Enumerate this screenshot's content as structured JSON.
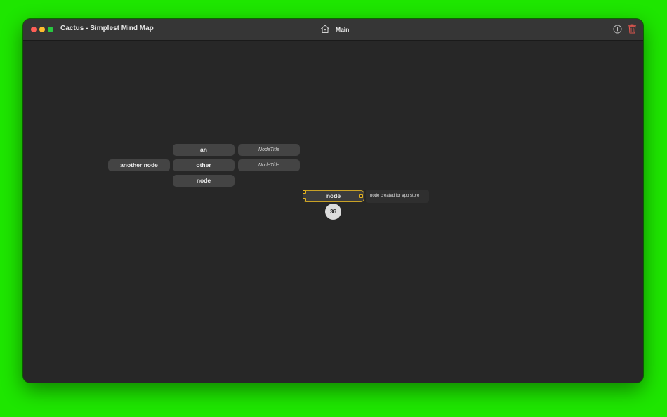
{
  "window": {
    "title": "Cactus - Simplest Mind Map"
  },
  "toolbar": {
    "home_icon": "house-icon",
    "page_name": "Main",
    "add_icon": "plus-circle-icon",
    "delete_icon": "trash-icon",
    "delete_color": "#e0564f"
  },
  "map": {
    "root_node": "another node",
    "children": [
      "an",
      "other",
      "node"
    ],
    "grandchildren": [
      "NodeTitle",
      "NodeTitle"
    ],
    "selected_node": {
      "label": "node",
      "note": "node created for app store",
      "count": "36",
      "accent_color": "#e6b31e"
    }
  }
}
